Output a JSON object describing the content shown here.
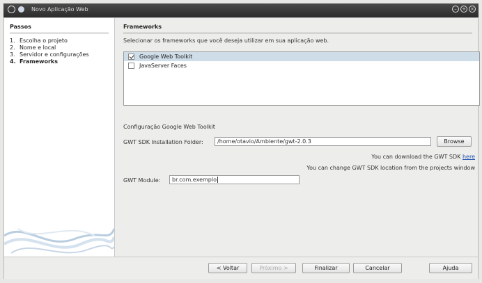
{
  "window": {
    "title": "Novo Aplicação Web"
  },
  "steps": {
    "header": "Passos",
    "items": [
      {
        "num": "1.",
        "label": "Escolha o projeto"
      },
      {
        "num": "2.",
        "label": "Nome e local"
      },
      {
        "num": "3.",
        "label": "Servidor e configurações"
      },
      {
        "num": "4.",
        "label": "Frameworks"
      }
    ]
  },
  "frameworks": {
    "header": "Frameworks",
    "description": "Selecionar os frameworks que você deseja utilizar em sua aplicação web.",
    "items": [
      {
        "label": "Google Web Toolkit",
        "checked": true,
        "selected": true
      },
      {
        "label": "JavaServer Faces",
        "checked": false,
        "selected": false
      }
    ]
  },
  "config": {
    "title": "Configuração Google Web Toolkit",
    "sdk_label": "GWT SDK Installation Folder:",
    "sdk_value": "/home/otavio/Ambiente/gwt-2.0.3",
    "browse_label": "Browse",
    "download_text": "You can download the GWT SDK",
    "download_link": "here",
    "change_text": "You can change GWT SDK location from the projects window",
    "module_label": "GWT Module:",
    "module_value": "br.com.exemplo"
  },
  "buttons": {
    "back": "< Voltar",
    "next": "Próximo >",
    "finish": "Finalizar",
    "cancel": "Cancelar",
    "help": "Ajuda"
  }
}
